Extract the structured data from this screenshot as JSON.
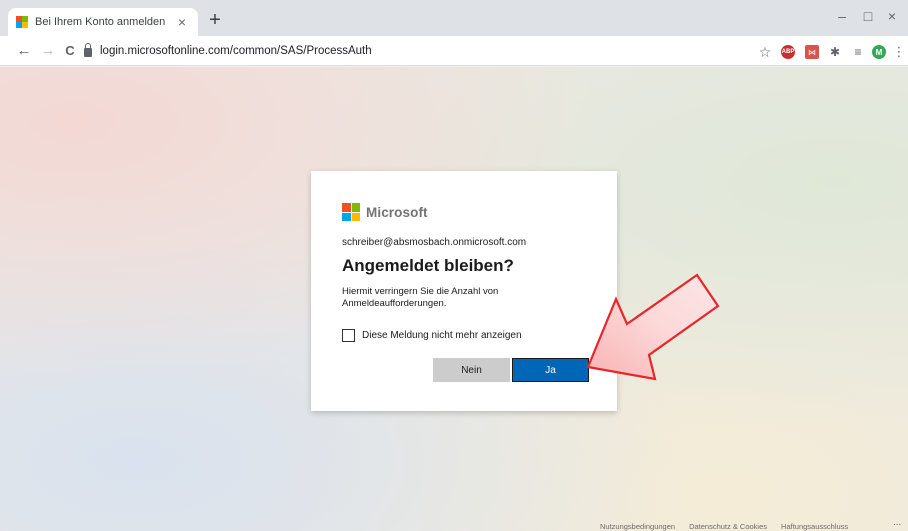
{
  "browser": {
    "tab": {
      "title": "Bei Ihrem Konto anmelden",
      "close_glyph": "×"
    },
    "new_tab_glyph": "+",
    "window_controls": {
      "minimize": "–",
      "maximize": "□",
      "close": "×"
    },
    "nav": {
      "back": "←",
      "forward": "→",
      "reload": "C"
    },
    "url": "login.microsoftonline.com/common/SAS/ProcessAuth",
    "toolbar_icons": {
      "bookmark": "☆",
      "abp": "ABP",
      "ext": "⋈",
      "puzzle": "✱",
      "reading": "≡",
      "avatar": "M",
      "menu": "⋮"
    }
  },
  "dialog": {
    "brand": "Microsoft",
    "brand_colors": [
      "#f25022",
      "#7fba00",
      "#00a4ef",
      "#ffb900"
    ],
    "email": "schreiber@absmosbach.onmicrosoft.com",
    "heading": "Angemeldet bleiben?",
    "description": "Hiermit verringern Sie die Anzahl von Anmeldeaufforderungen.",
    "checkbox_label": "Diese Meldung nicht mehr anzeigen",
    "checkbox_checked": false,
    "buttons": {
      "no": "Nein",
      "yes": "Ja"
    },
    "accent_color": "#0067b8"
  },
  "footer": {
    "links": [
      "Nutzungsbedingungen",
      "Datenschutz & Cookies",
      "Haftungsausschluss"
    ],
    "more": "..."
  }
}
